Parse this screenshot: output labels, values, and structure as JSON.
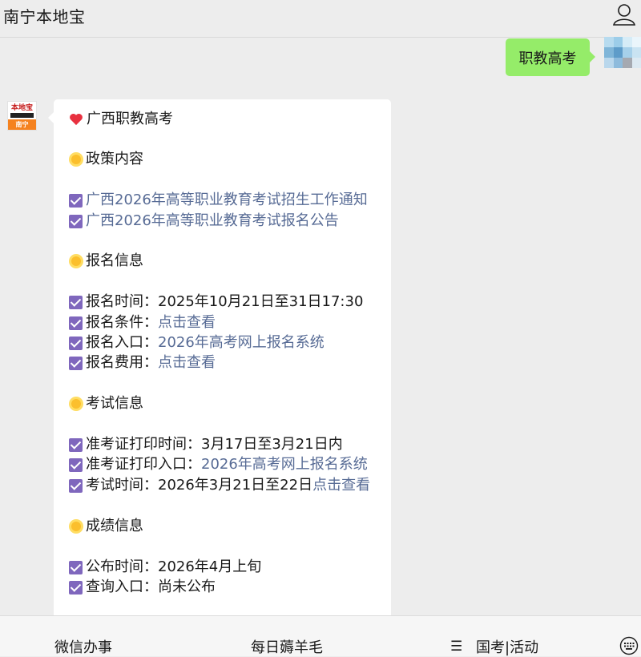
{
  "header": {
    "title": "南宁本地宝",
    "user_icon": "user-icon"
  },
  "outgoing_message": {
    "text": "职教高考"
  },
  "bot": {
    "logo_text": "本地宝",
    "logo_city": "南宁",
    "accent": "#f5821f"
  },
  "reply": {
    "title": "广西职教高考",
    "sections": {
      "policy": {
        "heading": "政策内容",
        "links": [
          "广西2026年高等职业教育考试招生工作通知",
          "广西2026年高等职业教育考试报名公告"
        ]
      },
      "registration": {
        "heading": "报名信息",
        "time_label": "报名时间：",
        "time_value": "2025年10月21日至31日17:30",
        "conditions_label": "报名条件：",
        "conditions_link": "点击查看",
        "entry_label": "报名入口：",
        "entry_link": "2026年高考网上报名系统",
        "fee_label": "报名费用：",
        "fee_link": "点击查看"
      },
      "exam": {
        "heading": "考试信息",
        "admit_time_label": "准考证打印时间：",
        "admit_time_value": "3月17日至3月21日内",
        "admit_entry_label": "准考证打印入口：",
        "admit_entry_link": "2026年高考网上报名系统",
        "exam_time_label": "考试时间：",
        "exam_time_value": "2026年3月21日至22日",
        "exam_time_link": "点击查看"
      },
      "score": {
        "heading": "成绩信息",
        "publish_label": "公布时间：",
        "publish_value": "2026年4月上旬",
        "query_label": "查询入口：",
        "query_value": "尚未公布"
      }
    }
  },
  "tabbar": {
    "tabs": [
      "微信办事",
      "每日薅羊毛",
      "国考|活动"
    ],
    "keyboard_icon": "keyboard-icon"
  },
  "colors": {
    "background": "#ededed",
    "outgoing_bubble": "#95ec69",
    "link": "#576b95",
    "checkbox": "#7f67bd"
  }
}
